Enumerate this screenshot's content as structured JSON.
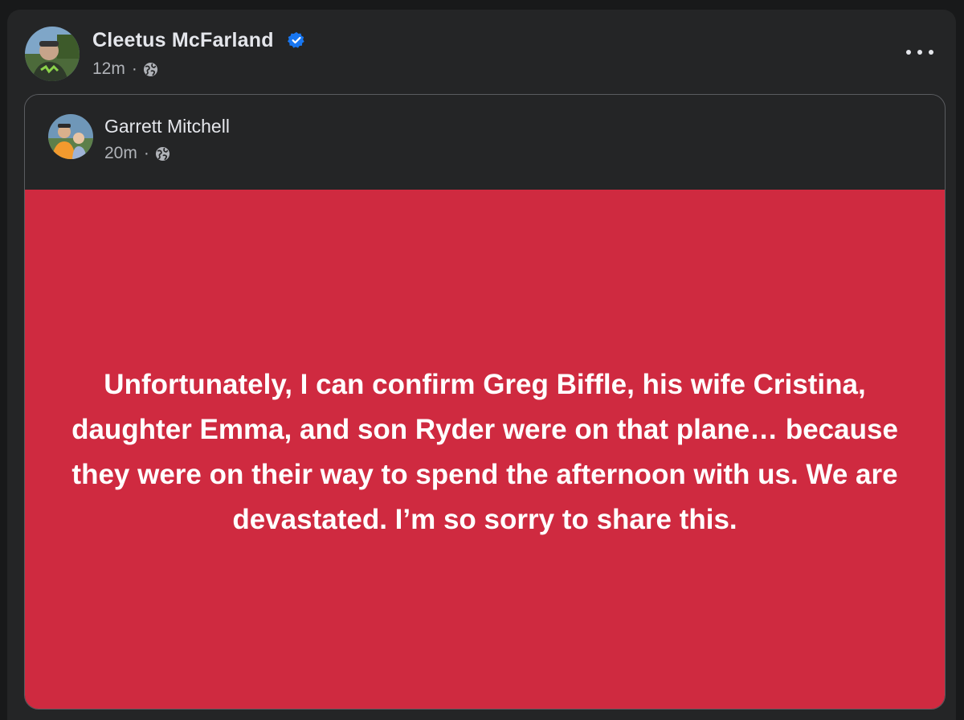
{
  "post": {
    "author_name": "Cleetus McFarland",
    "verified": true,
    "timestamp": "12m",
    "separator": "·",
    "audience_icon": "globe-icon"
  },
  "shared_post": {
    "author_name": "Garrett Mitchell",
    "timestamp": "20m",
    "separator": "·",
    "audience_icon": "globe-icon",
    "background_color": "#cf2a40",
    "body_text": "Unfortunately, I can confirm Greg Biffle, his wife Cristina, daughter Emma, and son Ryder were on that plane… because they were on their way to spend the afternoon with us. We are devastated. I’m so sorry to share this."
  },
  "colors": {
    "page_bg": "#18191a",
    "card_bg": "#242526",
    "primary_text": "#e4e6eb",
    "secondary_text": "#b0b3b8",
    "verified_blue": "#1877f2"
  }
}
